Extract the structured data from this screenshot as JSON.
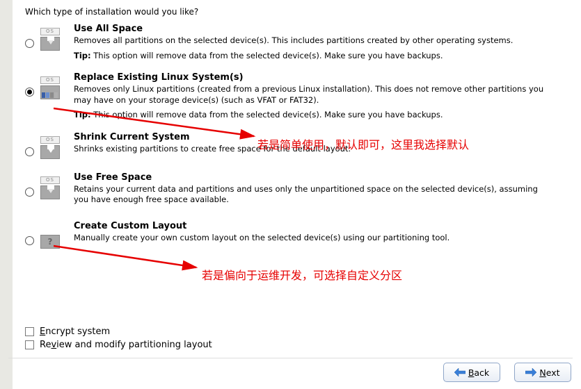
{
  "page": {
    "title": "Which type of installation would you like?"
  },
  "options": {
    "useAll": {
      "icon_label": "OS",
      "title": "Use All Space",
      "desc": "Removes all partitions on the selected device(s).  This includes partitions created by other operating systems.",
      "tip_label": "Tip:",
      "tip": "This option will remove data from the selected device(s).  Make sure you have backups."
    },
    "replace": {
      "icon_label": "OS",
      "title": "Replace Existing Linux System(s)",
      "desc": "Removes only Linux partitions (created from a previous Linux installation).  This does not remove other partitions you may have on your storage device(s) (such as VFAT or FAT32).",
      "tip_label": "Tip:",
      "tip": "This option will remove data from the selected device(s).  Make sure you have backups."
    },
    "shrink": {
      "icon_label": "OS",
      "title": "Shrink Current System",
      "desc": "Shrinks existing partitions to create free space for the default layout."
    },
    "free": {
      "icon_label": "OS",
      "title": "Use Free Space",
      "desc": "Retains your current data and partitions and uses only the unpartitioned space on the selected device(s), assuming you have enough free space available."
    },
    "custom": {
      "icon_glyph": "?",
      "title": "Create Custom Layout",
      "desc": "Manually create your own custom layout on the selected device(s) using our partitioning tool."
    }
  },
  "checkboxes": {
    "encrypt": "Encrypt system",
    "encrypt_ul": "E",
    "review": "Review and modify partitioning layout",
    "review_ul": "v"
  },
  "buttons": {
    "back": "Back",
    "back_ul": "B",
    "next": "Next",
    "next_ul": "N"
  },
  "annotations": {
    "a1": "若是简单使用，默认即可，这里我选择默认",
    "a2": "若是偏向于运维开发，可选择自定义分区"
  }
}
